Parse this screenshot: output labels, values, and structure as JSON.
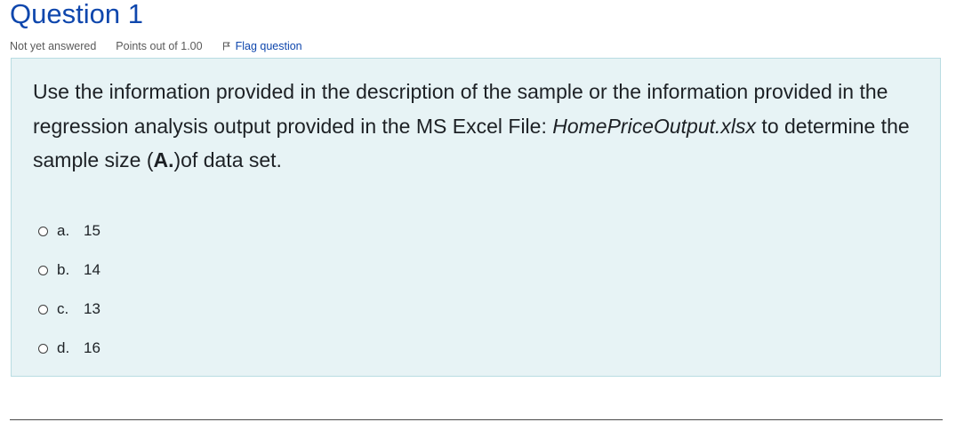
{
  "question": {
    "title": "Question 1",
    "state": "Not yet answered",
    "grade": "Points out of 1.00",
    "flag_label": "Flag question",
    "flag_icon": "flag-icon",
    "text": {
      "part1": "Use the information provided in the description of the sample or the information provided in the regression analysis output provided in the MS Excel File: ",
      "file_name": "HomePriceOutput.xlsx",
      "part2": " to determine the sample size (",
      "bold_label": "A.",
      "part3": ")of data set."
    }
  },
  "answers": [
    {
      "letter": "a.",
      "value": "15"
    },
    {
      "letter": "b.",
      "value": "14"
    },
    {
      "letter": "c.",
      "value": "13"
    },
    {
      "letter": "d.",
      "value": "16"
    }
  ],
  "colors": {
    "title": "#0f47ad",
    "link": "#0f47ad",
    "box_background": "#e7f3f5",
    "box_border": "#b8dce2"
  }
}
